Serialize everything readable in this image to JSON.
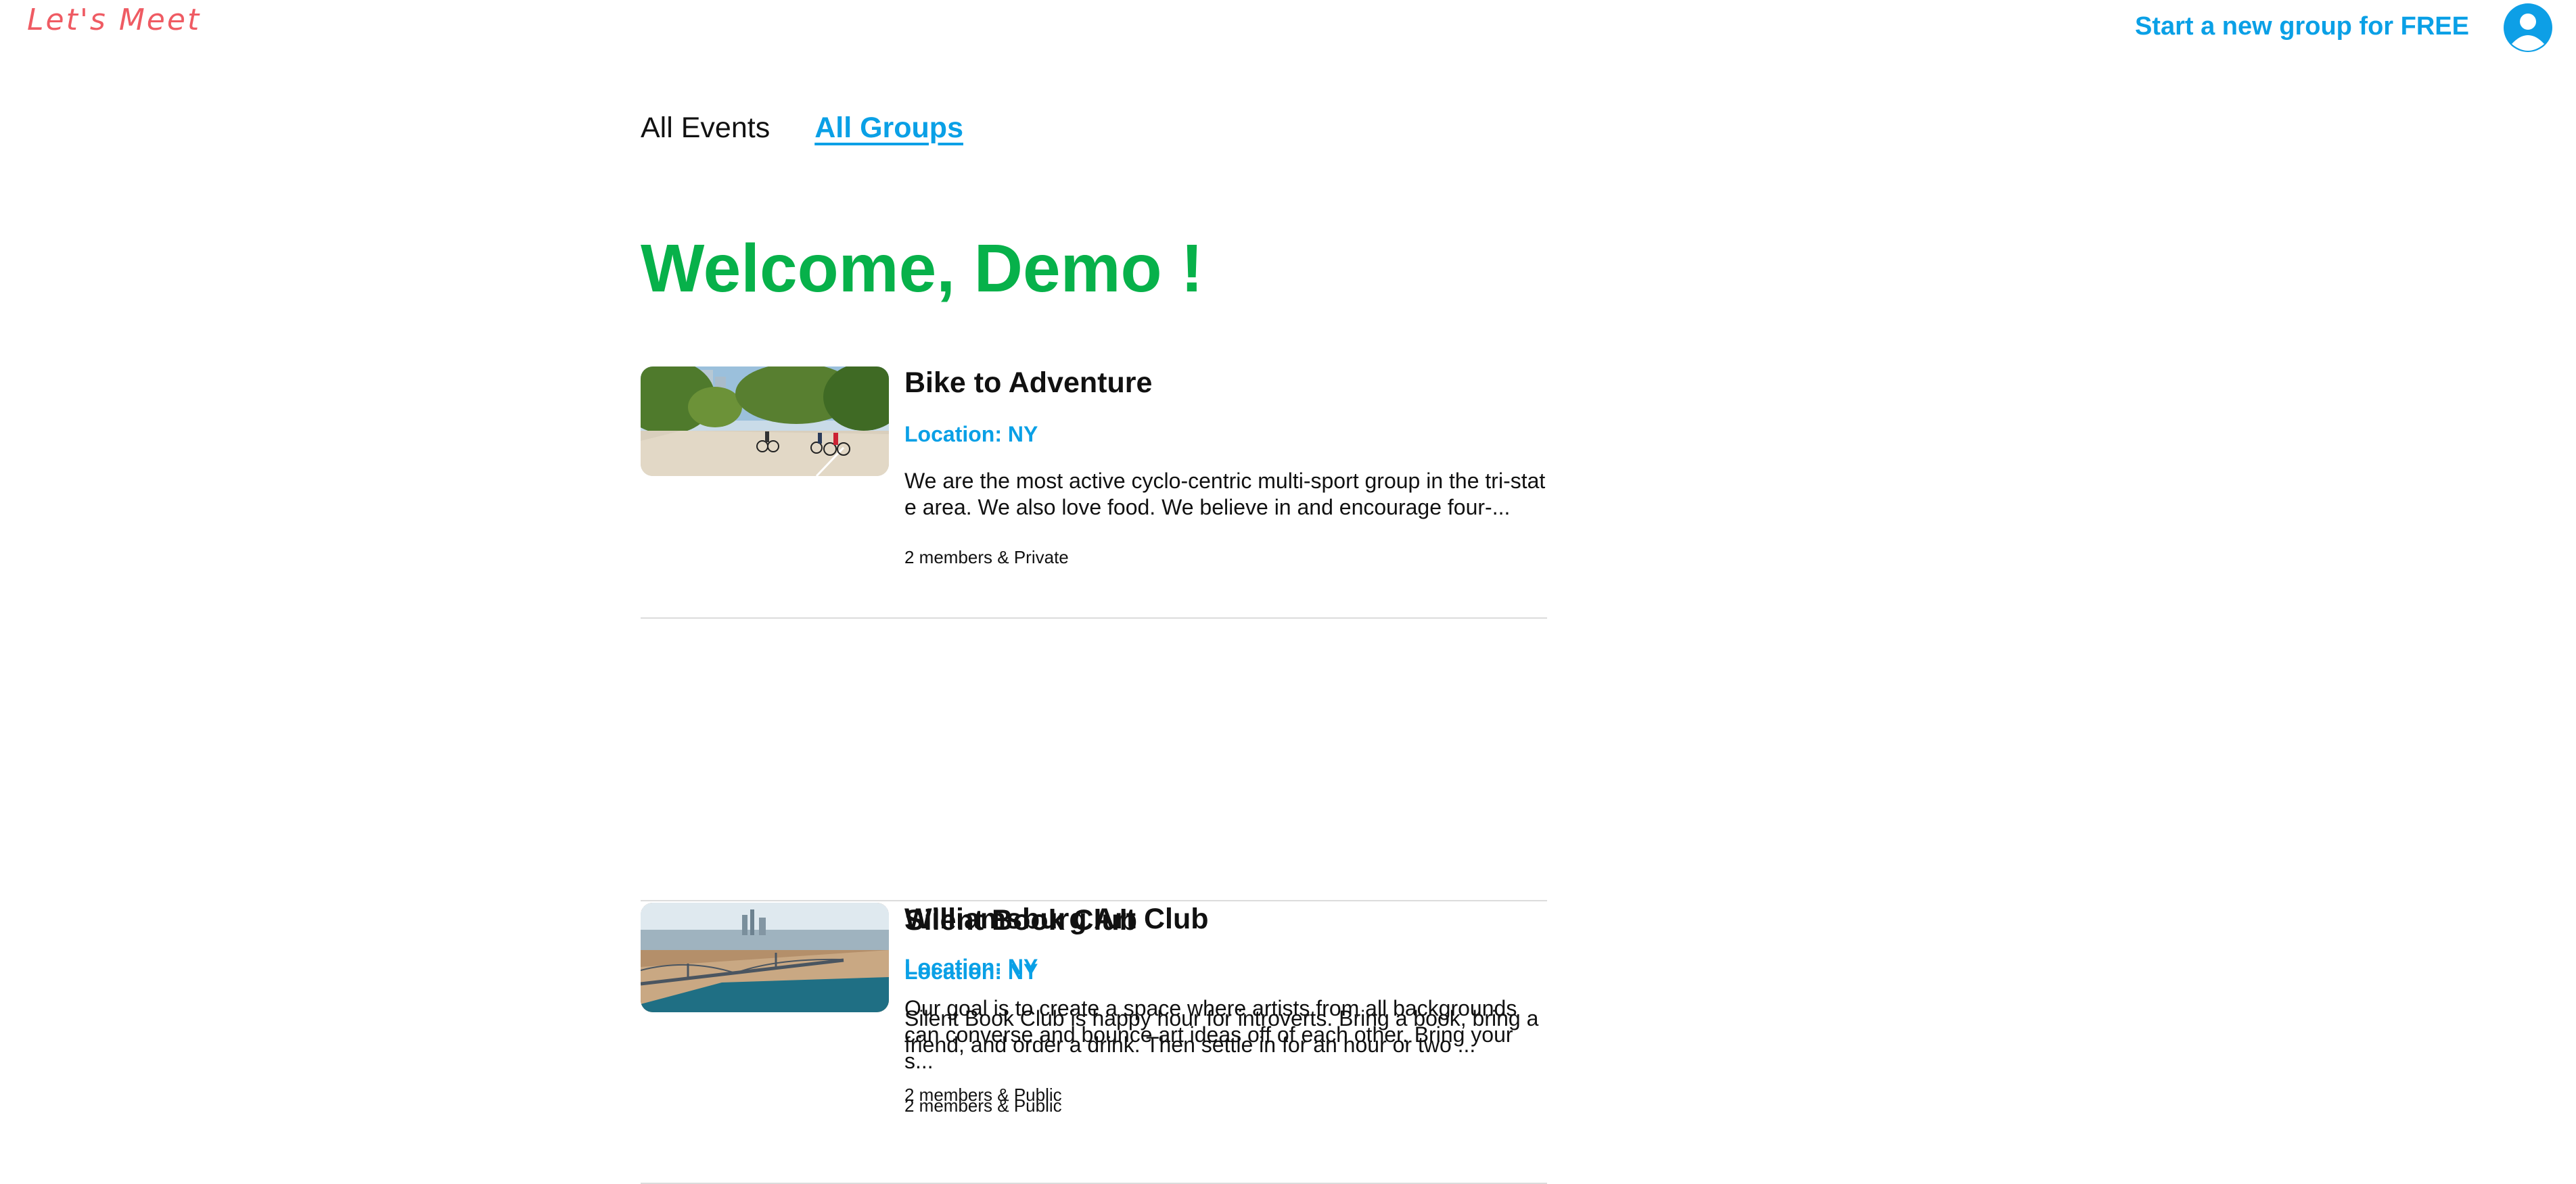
{
  "header": {
    "logo_text": "Let's Meet",
    "start_group_label": "Start a new group for FREE",
    "avatar_icon": "user-avatar-icon",
    "brand_color": "#ef5b63",
    "accent_color": "#0aa0e6"
  },
  "tabs": [
    {
      "label": "All Events",
      "active": false
    },
    {
      "label": "All Groups",
      "active": true
    }
  ],
  "welcome_text": "Welcome, Demo !",
  "welcome_color": "#07b14a",
  "groups": [
    {
      "title": "Bike to Adventure",
      "location": "Location: NY",
      "description": "We are the most active cyclo-centric multi-sport group in the tri-state area. We also love food. We believe in and encourage four-...",
      "meta": "2 members & Private"
    },
    {
      "title": "Silent Book Club",
      "location": "Location: NY",
      "description": "Silent Book Club is happy hour for introverts. Bring a book, bring a friend, and order a drink. Then settle in for an hour or two ...",
      "meta": "2 members & Public"
    },
    {
      "title": "Williamsburg Art Club",
      "location": "Location: NY",
      "description": "Our goal is to create a space where artists from all backgrounds can converse and bounce art ideas off of each other. Bring your s...",
      "meta": "2 members & Public"
    }
  ]
}
